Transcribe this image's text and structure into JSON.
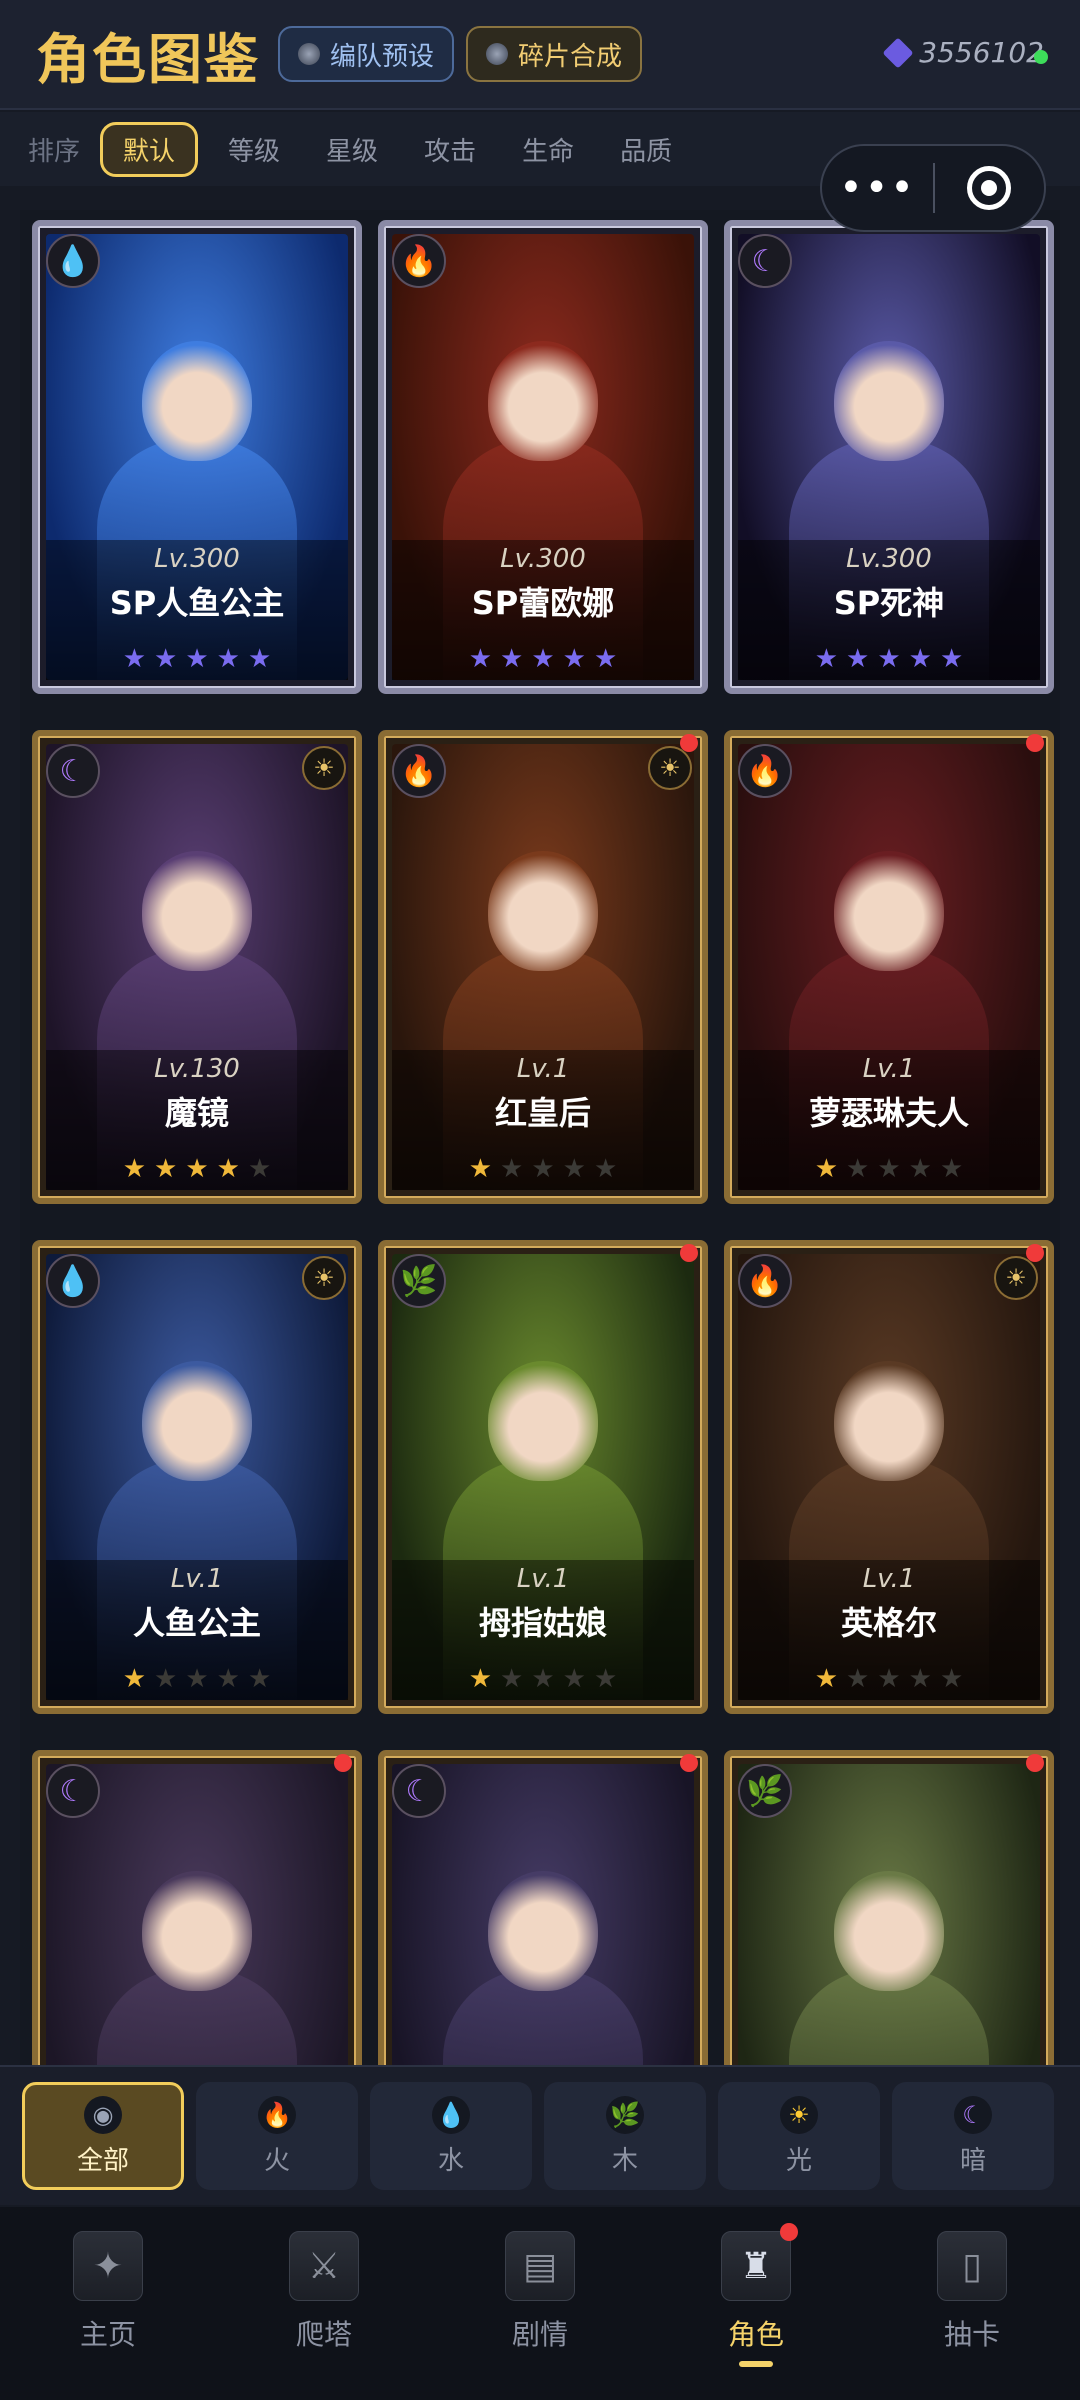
{
  "header": {
    "title": "角色图鉴",
    "team_preset_label": "编队预设",
    "shard_synth_label": "碎片合成",
    "currency_value": "3556102"
  },
  "sortbar": {
    "label": "排序",
    "options": [
      "默认",
      "等级",
      "星级",
      "攻击",
      "生命",
      "品质"
    ],
    "active": "默认"
  },
  "cards": [
    {
      "name": "SP人鱼公主",
      "level": "Lv.300",
      "element": "water",
      "stars": 5,
      "max_stars": 5,
      "sp": true,
      "red_dot": false,
      "sun": false,
      "theme": [
        "#0d2a6e",
        "#3f7de0"
      ]
    },
    {
      "name": "SP蕾欧娜",
      "level": "Lv.300",
      "element": "fire",
      "stars": 5,
      "max_stars": 5,
      "sp": true,
      "red_dot": false,
      "sun": false,
      "theme": [
        "#3a1208",
        "#8c2a1e"
      ]
    },
    {
      "name": "SP死神",
      "level": "Lv.300",
      "element": "dark",
      "stars": 5,
      "max_stars": 5,
      "sp": true,
      "red_dot": false,
      "sun": false,
      "theme": [
        "#120e26",
        "#5a5aa8"
      ]
    },
    {
      "name": "魔镜",
      "level": "Lv.130",
      "element": "dark",
      "stars": 4,
      "max_stars": 5,
      "sp": false,
      "red_dot": false,
      "sun": true,
      "theme": [
        "#1e1428",
        "#5a3f74"
      ]
    },
    {
      "name": "红皇后",
      "level": "Lv.1",
      "element": "fire",
      "stars": 1,
      "max_stars": 5,
      "sp": false,
      "red_dot": true,
      "sun": true,
      "theme": [
        "#2a160c",
        "#7a3a1c"
      ]
    },
    {
      "name": "萝瑟琳夫人",
      "level": "Lv.1",
      "element": "fire",
      "stars": 1,
      "max_stars": 5,
      "sp": false,
      "red_dot": true,
      "sun": false,
      "theme": [
        "#2a0e0e",
        "#6a1e22"
      ]
    },
    {
      "name": "人鱼公主",
      "level": "Lv.1",
      "element": "water",
      "stars": 1,
      "max_stars": 5,
      "sp": false,
      "red_dot": false,
      "sun": true,
      "theme": [
        "#0e1a3a",
        "#3c5aa0"
      ]
    },
    {
      "name": "拇指姑娘",
      "level": "Lv.1",
      "element": "wood",
      "stars": 1,
      "max_stars": 5,
      "sp": false,
      "red_dot": true,
      "sun": false,
      "theme": [
        "#1c2a10",
        "#6a8a2e"
      ]
    },
    {
      "name": "英格尔",
      "level": "Lv.1",
      "element": "fire",
      "stars": 1,
      "max_stars": 5,
      "sp": false,
      "red_dot": true,
      "sun": true,
      "theme": [
        "#24160e",
        "#5a3a24"
      ]
    },
    {
      "name": "",
      "level": "",
      "element": "dark",
      "stars": 0,
      "max_stars": 5,
      "sp": false,
      "red_dot": true,
      "sun": false,
      "theme": [
        "#1c1626",
        "#4a3a5c"
      ]
    },
    {
      "name": "",
      "level": "",
      "element": "dark",
      "stars": 0,
      "max_stars": 5,
      "sp": false,
      "red_dot": true,
      "sun": false,
      "theme": [
        "#181426",
        "#463c66"
      ]
    },
    {
      "name": "",
      "level": "",
      "element": "wood",
      "stars": 0,
      "max_stars": 5,
      "sp": false,
      "red_dot": true,
      "sun": false,
      "theme": [
        "#1e2614",
        "#6a7a46"
      ]
    }
  ],
  "elements": {
    "water": {
      "glyph": "💧",
      "color": "#4aa8ff"
    },
    "fire": {
      "glyph": "🔥",
      "color": "#ff5a2a"
    },
    "dark": {
      "glyph": "☾",
      "color": "#b07aff"
    },
    "wood": {
      "glyph": "🌿",
      "color": "#4ac05a"
    },
    "light": {
      "glyph": "☀",
      "color": "#ffcc33"
    }
  },
  "filters": [
    {
      "label": "全部",
      "icon": "all",
      "active": true
    },
    {
      "label": "火",
      "icon": "fire",
      "active": false
    },
    {
      "label": "水",
      "icon": "water",
      "active": false
    },
    {
      "label": "木",
      "icon": "wood",
      "active": false
    },
    {
      "label": "光",
      "icon": "light",
      "active": false
    },
    {
      "label": "暗",
      "icon": "dark",
      "active": false
    }
  ],
  "bottom_nav": [
    {
      "label": "主页",
      "icon": "compass-icon",
      "glyph": "✦",
      "active": false,
      "red_dot": false
    },
    {
      "label": "爬塔",
      "icon": "swords-shield-icon",
      "glyph": "⚔",
      "active": false,
      "red_dot": false
    },
    {
      "label": "剧情",
      "icon": "book-icon",
      "glyph": "▤",
      "active": false,
      "red_dot": false
    },
    {
      "label": "角色",
      "icon": "hooded-figure-icon",
      "glyph": "♜",
      "active": true,
      "red_dot": true
    },
    {
      "label": "抽卡",
      "icon": "card-icon",
      "glyph": "▯",
      "active": false,
      "red_dot": false
    }
  ]
}
